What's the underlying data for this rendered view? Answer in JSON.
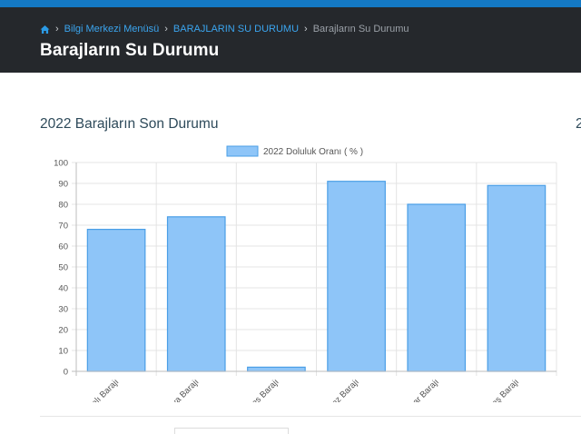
{
  "breadcrumb": {
    "items": [
      {
        "label": "Bilgi Merkezi Menüsü"
      },
      {
        "label": "BARAJLARIN SU DURUMU"
      }
    ],
    "current": "Barajların Su Durumu"
  },
  "page": {
    "title": "Barajların Su Durumu",
    "section_title": "2022 Barajların Son Durumu",
    "peek_text": "2"
  },
  "colors": {
    "topbar": "#1479c4",
    "header": "#25282c",
    "link": "#3ba5ef",
    "bar_fill": "#8ec5f8",
    "bar_stroke": "#4a9ee6"
  },
  "chart_data": {
    "type": "bar",
    "categories": [
      "Tahtalı Barajı",
      "Balçova Barajı",
      "Gördes Barajı",
      "Ürkmez Barajı",
      "Güzelhisar Barajı",
      "Alaçatı Kutlu Aktaş Barajı"
    ],
    "series": [
      {
        "name": "2022 Doluluk Oranı ( % )",
        "values": [
          68,
          74,
          2,
          91,
          80,
          89
        ]
      }
    ],
    "ylim": [
      0,
      100
    ],
    "yticks": [
      0,
      10,
      20,
      30,
      40,
      50,
      60,
      70,
      80,
      90,
      100
    ],
    "grid": true,
    "legend": "top-center"
  }
}
